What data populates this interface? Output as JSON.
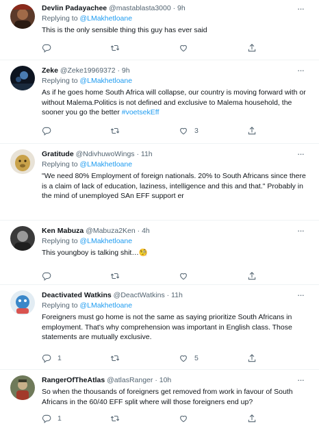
{
  "tweets": [
    {
      "name": "Devlin Padayachee",
      "handle": "@mastablasta3000",
      "time": "9h",
      "replying_label": "Replying to",
      "replying_to": "@LMakhetloane",
      "text": "This is the only sensible thing this guy has ever said",
      "hashtag": "",
      "emoji": "",
      "reply_count": "",
      "retweet_count": "",
      "like_count": ""
    },
    {
      "name": "Zeke",
      "handle": "@Zeke19969372",
      "time": "9h",
      "replying_label": "Replying to",
      "replying_to": "@LMakhetloane",
      "text": "As if he goes home South Africa will collapse, our country is moving forward with or without Malema.Politics is not defined and exclusive to Malema household, the sooner you go the better ",
      "hashtag": "#voetsekEff",
      "emoji": "",
      "reply_count": "",
      "retweet_count": "",
      "like_count": "3"
    },
    {
      "name": "Gratitude",
      "handle": "@NdivhuwoWings",
      "time": "11h",
      "replying_label": "Replying to",
      "replying_to": "@LMakhetloane",
      "text": "\"We need 80% Employment of foreign nationals. 20% to South Africans since there is a claim of lack of education, laziness, intelligence and this and that.\" Probably  in the mind of unemployed SAn EFF support er",
      "hashtag": "",
      "emoji": "",
      "reply_count": "",
      "retweet_count": "",
      "like_count": ""
    },
    {
      "name": "Ken Mabuza",
      "handle": "@Mabuza2Ken",
      "time": "4h",
      "replying_label": "Replying to",
      "replying_to": "@LMakhetloane",
      "text": "This youngboy is talking shit…",
      "hashtag": "",
      "emoji": "🧐",
      "reply_count": "",
      "retweet_count": "",
      "like_count": ""
    },
    {
      "name": "Deactivated Watkins",
      "handle": "@DeactWatkins",
      "time": "11h",
      "replying_label": "Replying to",
      "replying_to": "@LMakhetloane",
      "text": "Foreigners must go home is not the same as saying prioritize South Africans in employment.  That's why comprehension was important in English class. Those statements are mutually exclusive.",
      "hashtag": "",
      "emoji": "",
      "reply_count": "1",
      "retweet_count": "",
      "like_count": "5"
    },
    {
      "name": "RangerOfTheAtlas",
      "handle": "@atlasRanger",
      "time": "10h",
      "replying_label": "",
      "replying_to": "",
      "text": "So when the thousands of foreigners get removed from work in favour of South Africans in the 60/40 EFF split where will those foreigners end up?",
      "hashtag": "",
      "emoji": "",
      "reply_count": "1",
      "retweet_count": "",
      "like_count": ""
    }
  ],
  "separator": "·",
  "more_glyph": "···",
  "icons": [
    "reply-icon",
    "retweet-icon",
    "like-icon",
    "share-icon",
    "more-icon"
  ],
  "colors": {
    "link": "#1d9bf0",
    "muted": "#536471",
    "text": "#0f1419",
    "divider": "#eff3f4"
  }
}
